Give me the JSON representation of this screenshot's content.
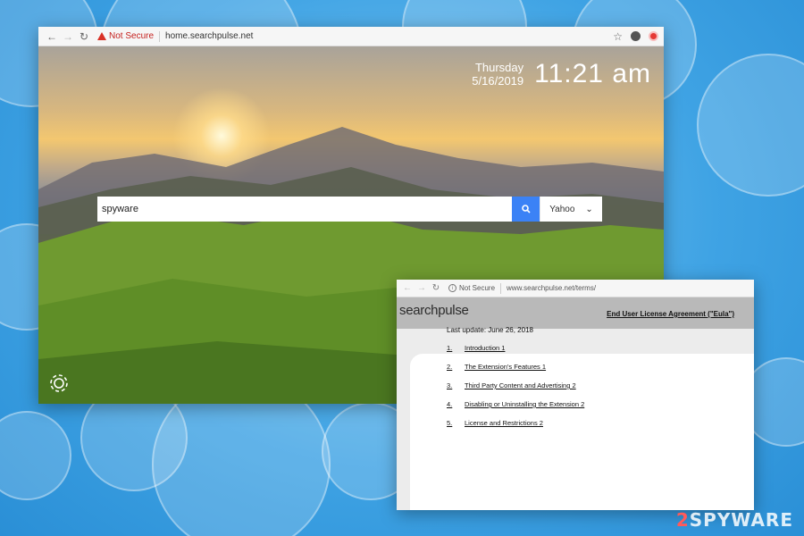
{
  "browser_main": {
    "security_label": "Not Secure",
    "url": "home.searchpulse.net"
  },
  "newtab": {
    "day": "Thursday",
    "date": "5/16/2019",
    "time": "11:21 am",
    "search_value": "spyware",
    "search_engine": "Yahoo"
  },
  "browser_terms": {
    "security_label": "Not Secure",
    "url": "www.searchpulse.net/terms/",
    "logo": "searchpulse",
    "eula_title": "End User License Agreement (\"Eula\")",
    "last_update": "Last update: June 26, 2018",
    "toc": [
      {
        "num": "1.",
        "label": "Introduction 1"
      },
      {
        "num": "2.",
        "label": "The Extension's Features 1"
      },
      {
        "num": "3.",
        "label": "Third Party Content and Advertising 2"
      },
      {
        "num": "4.",
        "label": "Disabling or Uninstalling the Extension 2"
      },
      {
        "num": "5.",
        "label": "License and Restrictions 2"
      }
    ]
  },
  "watermark": {
    "prefix": "2",
    "suffix": "SPYWARE"
  },
  "colors": {
    "accent_blue": "#3b82f6",
    "warning_red": "#d93025",
    "background_blue": "#3fa3e4"
  }
}
